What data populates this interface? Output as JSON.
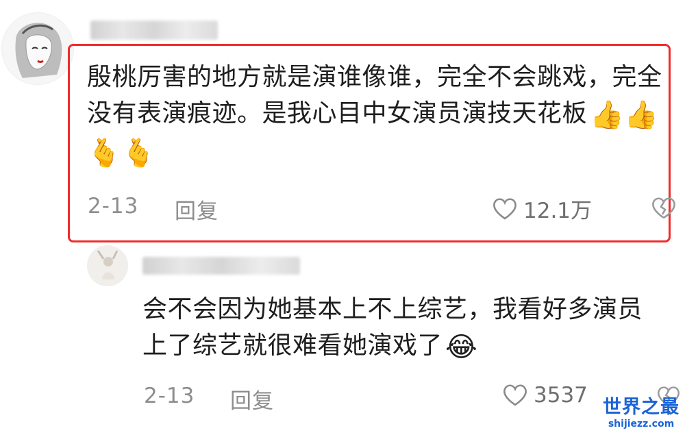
{
  "comments": [
    {
      "text": "殷桃厉害的地方就是演谁像谁，完全不会跳戏，完全没有表演痕迹。是我心目中女演员演技天花板",
      "emojis": "👍👍🫰🫰",
      "date": "2-13",
      "reply_label": "回复",
      "likes": "12.1万"
    },
    {
      "text": "会不会因为她基本上不上综艺，我看好多演员上了综艺就很难看她演戏了",
      "emojis": "😂",
      "date": "2-13",
      "reply_label": "回复",
      "likes": "3537"
    }
  ],
  "watermark": {
    "name": "世界之最",
    "url": "shijiezz.com"
  },
  "colors": {
    "highlight_border": "#ef2b2b",
    "watermark": "#1b63d7"
  }
}
